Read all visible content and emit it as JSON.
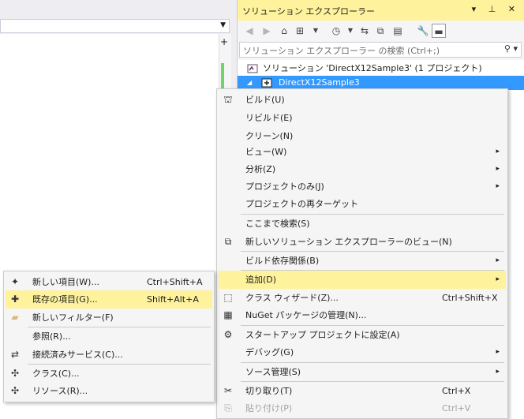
{
  "colors": {
    "highlight": "#fff29d",
    "selection": "#3399ff",
    "menu_bg": "#f5f5f5"
  },
  "editor": {
    "scroll_button": "+"
  },
  "solution_explorer": {
    "title": "ソリューション エクスプローラー",
    "title_buttons": "▾ ⊥ ✕",
    "search_placeholder": "ソリューション エクスプローラー の検索 (Ctrl+;)",
    "tree": [
      {
        "label": "ソリューション 'DirectX12Sample3' (1 プロジェクト)"
      },
      {
        "label": "DirectX12Sample3"
      }
    ]
  },
  "context_menu": {
    "items": [
      {
        "label": "ビルド(U)"
      },
      {
        "label": "リビルド(E)"
      },
      {
        "label": "クリーン(N)"
      },
      {
        "label": "ビュー(W)",
        "submenu": "▸"
      },
      {
        "label": "分析(Z)",
        "submenu": "▸"
      },
      {
        "label": "プロジェクトのみ(J)",
        "submenu": "▸"
      },
      {
        "label": "プロジェクトの再ターゲット"
      },
      {
        "label": "ここまで検索(S)"
      },
      {
        "label": "新しいソリューション エクスプローラーのビュー(N)"
      },
      {
        "label": "ビルド依存関係(B)",
        "submenu": "▸"
      },
      {
        "label": "追加(D)",
        "submenu": "▸"
      },
      {
        "label": "クラス ウィザード(Z)...",
        "shortcut": "Ctrl+Shift+X"
      },
      {
        "label": "NuGet パッケージの管理(N)..."
      },
      {
        "label": "スタートアップ プロジェクトに設定(A)"
      },
      {
        "label": "デバッグ(G)",
        "submenu": "▸"
      },
      {
        "label": "ソース管理(S)",
        "submenu": "▸"
      },
      {
        "label": "切り取り(T)",
        "shortcut": "Ctrl+X"
      },
      {
        "label": "貼り付け(P)",
        "shortcut": "Ctrl+V"
      }
    ]
  },
  "add_submenu": {
    "items": [
      {
        "label": "新しい項目(W)...",
        "shortcut": "Ctrl+Shift+A"
      },
      {
        "label": "既存の項目(G)...",
        "shortcut": "Shift+Alt+A"
      },
      {
        "label": "新しいフィルター(F)"
      },
      {
        "label": "参照(R)..."
      },
      {
        "label": "接続済みサービス(C)..."
      },
      {
        "label": "クラス(C)..."
      },
      {
        "label": "リソース(R)..."
      }
    ]
  }
}
